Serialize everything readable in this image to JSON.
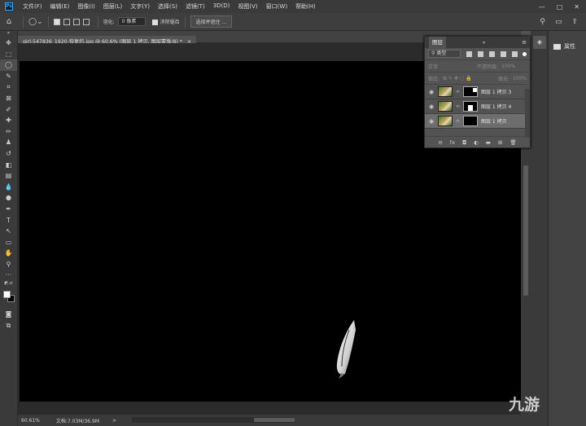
{
  "app": {
    "logo": "Ps"
  },
  "menu": [
    "文件(F)",
    "编辑(E)",
    "图像(I)",
    "图层(L)",
    "文字(Y)",
    "选择(S)",
    "滤镜(T)",
    "3D(D)",
    "视图(V)",
    "窗口(W)",
    "帮助(H)"
  ],
  "window_controls": [
    "—",
    "□",
    "✕"
  ],
  "options": {
    "feather_label": "羽化:",
    "feather_value": "0 像素",
    "antialias_label": "消除锯齿",
    "select_mask_label": "选择并遮住 ..."
  },
  "document": {
    "tab_title": "girl-547836_1920-恢复的.jpg @ 60.6% (图层 1 拷贝, 图层蒙版/8) *",
    "close": "×"
  },
  "status": {
    "zoom": "60.61%",
    "doc_info": "文档:7.03M/36.9M",
    "arrow": ">"
  },
  "properties_panel": {
    "label": "属性"
  },
  "layers_panel": {
    "title": "图层",
    "menu_icon": "≡",
    "collapse": "»",
    "kind_filter": "类型",
    "blend_mode": "正常",
    "opacity_label": "不透明度:",
    "opacity_value": "100%",
    "lock_label": "锁定:",
    "fill_label": "填充:",
    "fill_value": "100%",
    "layers": [
      {
        "name": "图层 1 拷贝 3",
        "selected": false
      },
      {
        "name": "图层 1 拷贝 4",
        "selected": false
      },
      {
        "name": "图层 1 拷贝",
        "selected": true
      }
    ],
    "footer_icons": [
      "link-icon",
      "fx-icon",
      "mask-icon",
      "adjustment-icon",
      "folder-icon",
      "new-layer-icon",
      "trash-icon"
    ],
    "footer_glyphs": [
      "⊖",
      "fx",
      "◘",
      "◐",
      "▬",
      "⊞",
      "🗑"
    ]
  },
  "watermark": "九游",
  "colors": {
    "canvas": "#000000",
    "ui_dark": "#3a3a3a",
    "ui_mid": "#535353",
    "accent": "#31a8ff"
  }
}
